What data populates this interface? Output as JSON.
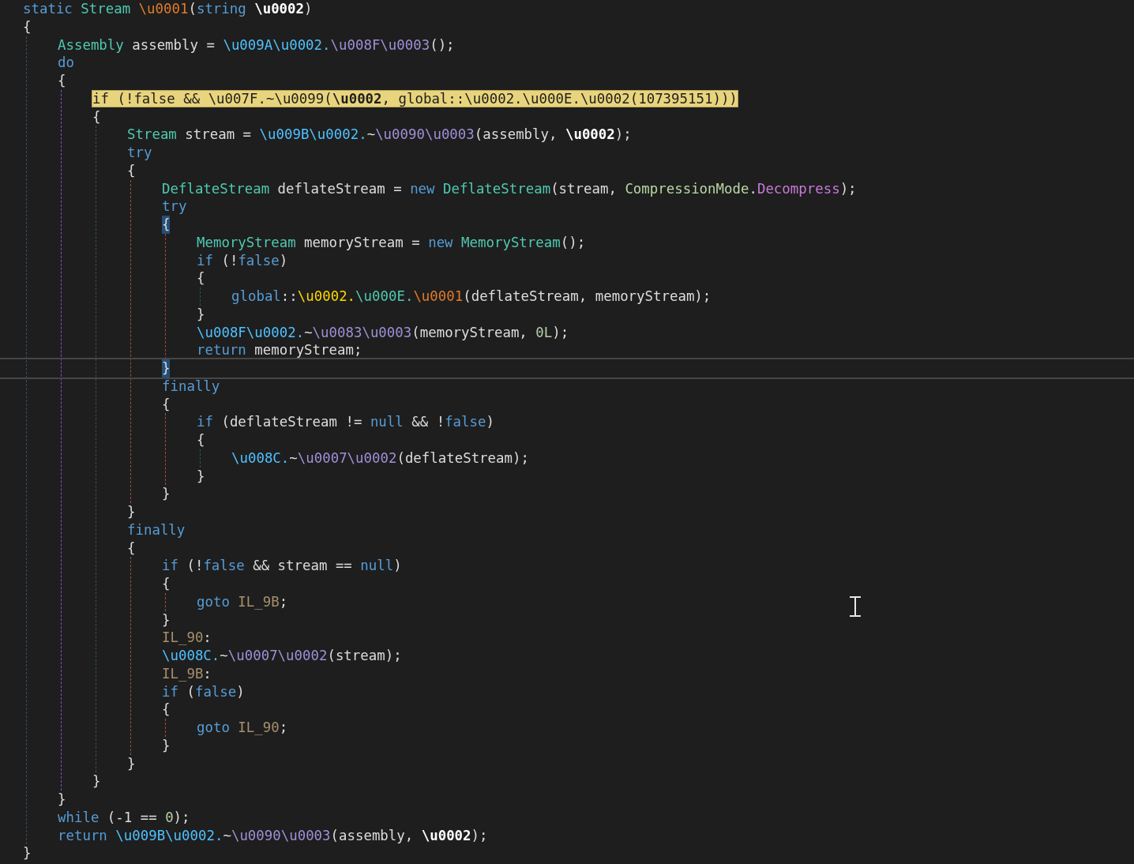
{
  "code": {
    "lines": [
      {
        "tokens": [
          {
            "text": "static ",
            "kind": "kw"
          },
          {
            "text": "Stream ",
            "kind": "type"
          },
          {
            "text": "\\u0001",
            "kind": "method"
          },
          {
            "text": "(",
            "kind": "id"
          },
          {
            "text": "string ",
            "kind": "kw"
          },
          {
            "text": "\\u0002",
            "kind": "param"
          },
          {
            "text": ")",
            "kind": "id"
          }
        ],
        "highlighted": false,
        "current": false,
        "brace_match": false
      },
      {
        "tokens": [
          {
            "text": "{",
            "kind": "id"
          }
        ],
        "highlighted": false,
        "current": false,
        "brace_match": false,
        "children": [
          {
            "tokens": [
              {
                "text": "Assembly",
                "kind": "type"
              },
              {
                "text": " assembly = ",
                "kind": "id"
              },
              {
                "text": "\\u009A\\u0002.",
                "kind": "class"
              },
              {
                "text": "\\u008F\\u0003",
                "kind": "call"
              },
              {
                "text": "();",
                "kind": "id"
              }
            ],
            "highlighted": false,
            "current": false,
            "brace_match": false
          },
          {
            "tokens": [
              {
                "text": "do",
                "kind": "kw"
              }
            ],
            "highlighted": false,
            "current": false,
            "brace_match": false
          },
          {
            "tokens": [
              {
                "text": "{",
                "kind": "id"
              }
            ],
            "highlighted": false,
            "current": false,
            "brace_match": false,
            "children": [
              {
                "tokens": [
                  {
                    "text": "if",
                    "kind": "kw"
                  },
                  {
                    "text": " (!",
                    "kind": "id"
                  },
                  {
                    "text": "false",
                    "kind": "kw"
                  },
                  {
                    "text": " && ",
                    "kind": "id"
                  },
                  {
                    "text": "\\u007F.",
                    "kind": "class"
                  },
                  {
                    "text": "~",
                    "kind": "id"
                  },
                  {
                    "text": "\\u0099",
                    "kind": "call"
                  },
                  {
                    "text": "(",
                    "kind": "id"
                  },
                  {
                    "text": "\\u0002",
                    "kind": "param"
                  },
                  {
                    "text": ", ",
                    "kind": "id"
                  },
                  {
                    "text": "global",
                    "kind": "kw"
                  },
                  {
                    "text": "::",
                    "kind": "id"
                  },
                  {
                    "text": "\\u0002.",
                    "kind": "field"
                  },
                  {
                    "text": "\\u000E.",
                    "kind": "static"
                  },
                  {
                    "text": "\\u0002",
                    "kind": "method"
                  },
                  {
                    "text": "(",
                    "kind": "id"
                  },
                  {
                    "text": "107395151",
                    "kind": "num"
                  },
                  {
                    "text": ")))",
                    "kind": "id"
                  }
                ],
                "highlighted": true,
                "current": false,
                "brace_match": false
              },
              {
                "tokens": [
                  {
                    "text": "{",
                    "kind": "id"
                  }
                ],
                "highlighted": false,
                "current": false,
                "brace_match": false,
                "children": [
                  {
                    "tokens": [
                      {
                        "text": "Stream",
                        "kind": "type"
                      },
                      {
                        "text": " stream = ",
                        "kind": "id"
                      },
                      {
                        "text": "\\u009B\\u0002.",
                        "kind": "class"
                      },
                      {
                        "text": "~",
                        "kind": "id"
                      },
                      {
                        "text": "\\u0090\\u0003",
                        "kind": "call"
                      },
                      {
                        "text": "(assembly, ",
                        "kind": "id"
                      },
                      {
                        "text": "\\u0002",
                        "kind": "param"
                      },
                      {
                        "text": ");",
                        "kind": "id"
                      }
                    ],
                    "highlighted": false,
                    "current": false,
                    "brace_match": false
                  },
                  {
                    "tokens": [
                      {
                        "text": "try",
                        "kind": "kw"
                      }
                    ],
                    "highlighted": false,
                    "current": false,
                    "brace_match": false
                  },
                  {
                    "tokens": [
                      {
                        "text": "{",
                        "kind": "id"
                      }
                    ],
                    "highlighted": false,
                    "current": false,
                    "brace_match": false,
                    "children": [
                      {
                        "tokens": [
                          {
                            "text": "DeflateStream",
                            "kind": "type"
                          },
                          {
                            "text": " deflateStream = ",
                            "kind": "id"
                          },
                          {
                            "text": "new ",
                            "kind": "kw"
                          },
                          {
                            "text": "DeflateStream",
                            "kind": "type"
                          },
                          {
                            "text": "(stream, ",
                            "kind": "id"
                          },
                          {
                            "text": "CompressionMode",
                            "kind": "enum"
                          },
                          {
                            "text": ".",
                            "kind": "id"
                          },
                          {
                            "text": "Decompress",
                            "kind": "member"
                          },
                          {
                            "text": ");",
                            "kind": "id"
                          }
                        ],
                        "highlighted": false,
                        "current": false,
                        "brace_match": false
                      },
                      {
                        "tokens": [
                          {
                            "text": "try",
                            "kind": "kw"
                          }
                        ],
                        "highlighted": false,
                        "current": false,
                        "brace_match": false
                      },
                      {
                        "tokens": [
                          {
                            "text": "{",
                            "kind": "id"
                          }
                        ],
                        "highlighted": false,
                        "current": false,
                        "brace_match": true,
                        "children": [
                          {
                            "tokens": [
                              {
                                "text": "MemoryStream",
                                "kind": "type"
                              },
                              {
                                "text": " memoryStream = ",
                                "kind": "id"
                              },
                              {
                                "text": "new ",
                                "kind": "kw"
                              },
                              {
                                "text": "MemoryStream",
                                "kind": "type"
                              },
                              {
                                "text": "();",
                                "kind": "id"
                              }
                            ],
                            "highlighted": false,
                            "current": false,
                            "brace_match": false
                          },
                          {
                            "tokens": [
                              {
                                "text": "if",
                                "kind": "kw"
                              },
                              {
                                "text": " (!",
                                "kind": "id"
                              },
                              {
                                "text": "false",
                                "kind": "kw"
                              },
                              {
                                "text": ")",
                                "kind": "id"
                              }
                            ],
                            "highlighted": false,
                            "current": false,
                            "brace_match": false
                          },
                          {
                            "tokens": [
                              {
                                "text": "{",
                                "kind": "id"
                              }
                            ],
                            "highlighted": false,
                            "current": false,
                            "brace_match": false,
                            "children": [
                              {
                                "tokens": [
                                  {
                                    "text": "global",
                                    "kind": "kw"
                                  },
                                  {
                                    "text": "::",
                                    "kind": "id"
                                  },
                                  {
                                    "text": "\\u0002.",
                                    "kind": "field"
                                  },
                                  {
                                    "text": "\\u000E.",
                                    "kind": "static"
                                  },
                                  {
                                    "text": "\\u0001",
                                    "kind": "method"
                                  },
                                  {
                                    "text": "(deflateStream, memoryStream);",
                                    "kind": "id"
                                  }
                                ],
                                "highlighted": false,
                                "current": false,
                                "brace_match": false
                              }
                            ]
                          },
                          {
                            "tokens": [
                              {
                                "text": "}",
                                "kind": "id"
                              }
                            ],
                            "highlighted": false,
                            "current": false,
                            "brace_match": false
                          },
                          {
                            "tokens": [
                              {
                                "text": "\\u008F\\u0002.",
                                "kind": "class"
                              },
                              {
                                "text": "~",
                                "kind": "id"
                              },
                              {
                                "text": "\\u0083\\u0003",
                                "kind": "call"
                              },
                              {
                                "text": "(memoryStream, ",
                                "kind": "id"
                              },
                              {
                                "text": "0L",
                                "kind": "num"
                              },
                              {
                                "text": ");",
                                "kind": "id"
                              }
                            ],
                            "highlighted": false,
                            "current": false,
                            "brace_match": false
                          },
                          {
                            "tokens": [
                              {
                                "text": "return",
                                "kind": "kw"
                              },
                              {
                                "text": " memoryStream;",
                                "kind": "id"
                              }
                            ],
                            "highlighted": false,
                            "current": false,
                            "brace_match": false
                          }
                        ]
                      },
                      {
                        "tokens": [
                          {
                            "text": "}",
                            "kind": "id"
                          }
                        ],
                        "highlighted": false,
                        "current": true,
                        "brace_match": true
                      },
                      {
                        "tokens": [
                          {
                            "text": "finally",
                            "kind": "kw"
                          }
                        ],
                        "highlighted": false,
                        "current": false,
                        "brace_match": false
                      },
                      {
                        "tokens": [
                          {
                            "text": "{",
                            "kind": "id"
                          }
                        ],
                        "highlighted": false,
                        "current": false,
                        "brace_match": false,
                        "children": [
                          {
                            "tokens": [
                              {
                                "text": "if",
                                "kind": "kw"
                              },
                              {
                                "text": " (deflateStream != ",
                                "kind": "id"
                              },
                              {
                                "text": "null",
                                "kind": "kw"
                              },
                              {
                                "text": " && !",
                                "kind": "id"
                              },
                              {
                                "text": "false",
                                "kind": "kw"
                              },
                              {
                                "text": ")",
                                "kind": "id"
                              }
                            ],
                            "highlighted": false,
                            "current": false,
                            "brace_match": false
                          },
                          {
                            "tokens": [
                              {
                                "text": "{",
                                "kind": "id"
                              }
                            ],
                            "highlighted": false,
                            "current": false,
                            "brace_match": false,
                            "children": [
                              {
                                "tokens": [
                                  {
                                    "text": "\\u008C.",
                                    "kind": "class"
                                  },
                                  {
                                    "text": "~",
                                    "kind": "id"
                                  },
                                  {
                                    "text": "\\u0007\\u0002",
                                    "kind": "call"
                                  },
                                  {
                                    "text": "(deflateStream);",
                                    "kind": "id"
                                  }
                                ],
                                "highlighted": false,
                                "current": false,
                                "brace_match": false
                              }
                            ]
                          },
                          {
                            "tokens": [
                              {
                                "text": "}",
                                "kind": "id"
                              }
                            ],
                            "highlighted": false,
                            "current": false,
                            "brace_match": false
                          }
                        ]
                      },
                      {
                        "tokens": [
                          {
                            "text": "}",
                            "kind": "id"
                          }
                        ],
                        "highlighted": false,
                        "current": false,
                        "brace_match": false
                      }
                    ]
                  },
                  {
                    "tokens": [
                      {
                        "text": "}",
                        "kind": "id"
                      }
                    ],
                    "highlighted": false,
                    "current": false,
                    "brace_match": false
                  },
                  {
                    "tokens": [
                      {
                        "text": "finally",
                        "kind": "kw"
                      }
                    ],
                    "highlighted": false,
                    "current": false,
                    "brace_match": false
                  },
                  {
                    "tokens": [
                      {
                        "text": "{",
                        "kind": "id"
                      }
                    ],
                    "highlighted": false,
                    "current": false,
                    "brace_match": false,
                    "children": [
                      {
                        "tokens": [
                          {
                            "text": "if",
                            "kind": "kw"
                          },
                          {
                            "text": " (!",
                            "kind": "id"
                          },
                          {
                            "text": "false",
                            "kind": "kw"
                          },
                          {
                            "text": " && stream == ",
                            "kind": "id"
                          },
                          {
                            "text": "null",
                            "kind": "kw"
                          },
                          {
                            "text": ")",
                            "kind": "id"
                          }
                        ],
                        "highlighted": false,
                        "current": false,
                        "brace_match": false
                      },
                      {
                        "tokens": [
                          {
                            "text": "{",
                            "kind": "id"
                          }
                        ],
                        "highlighted": false,
                        "current": false,
                        "brace_match": false,
                        "children": [
                          {
                            "tokens": [
                              {
                                "text": "goto ",
                                "kind": "kw"
                              },
                              {
                                "text": "IL_9B",
                                "kind": "label"
                              },
                              {
                                "text": ";",
                                "kind": "id"
                              }
                            ],
                            "highlighted": false,
                            "current": false,
                            "brace_match": false
                          }
                        ]
                      },
                      {
                        "tokens": [
                          {
                            "text": "}",
                            "kind": "id"
                          }
                        ],
                        "highlighted": false,
                        "current": false,
                        "brace_match": false
                      },
                      {
                        "tokens": [
                          {
                            "text": "IL_90",
                            "kind": "label"
                          },
                          {
                            "text": ":",
                            "kind": "id"
                          }
                        ],
                        "highlighted": false,
                        "current": false,
                        "brace_match": false
                      },
                      {
                        "tokens": [
                          {
                            "text": "\\u008C.",
                            "kind": "class"
                          },
                          {
                            "text": "~",
                            "kind": "id"
                          },
                          {
                            "text": "\\u0007\\u0002",
                            "kind": "call"
                          },
                          {
                            "text": "(stream);",
                            "kind": "id"
                          }
                        ],
                        "highlighted": false,
                        "current": false,
                        "brace_match": false
                      },
                      {
                        "tokens": [
                          {
                            "text": "IL_9B",
                            "kind": "label"
                          },
                          {
                            "text": ":",
                            "kind": "id"
                          }
                        ],
                        "highlighted": false,
                        "current": false,
                        "brace_match": false
                      },
                      {
                        "tokens": [
                          {
                            "text": "if",
                            "kind": "kw"
                          },
                          {
                            "text": " (",
                            "kind": "id"
                          },
                          {
                            "text": "false",
                            "kind": "kw"
                          },
                          {
                            "text": ")",
                            "kind": "id"
                          }
                        ],
                        "highlighted": false,
                        "current": false,
                        "brace_match": false
                      },
                      {
                        "tokens": [
                          {
                            "text": "{",
                            "kind": "id"
                          }
                        ],
                        "highlighted": false,
                        "current": false,
                        "brace_match": false,
                        "children": [
                          {
                            "tokens": [
                              {
                                "text": "goto ",
                                "kind": "kw"
                              },
                              {
                                "text": "IL_90",
                                "kind": "label"
                              },
                              {
                                "text": ";",
                                "kind": "id"
                              }
                            ],
                            "highlighted": false,
                            "current": false,
                            "brace_match": false
                          }
                        ]
                      },
                      {
                        "tokens": [
                          {
                            "text": "}",
                            "kind": "id"
                          }
                        ],
                        "highlighted": false,
                        "current": false,
                        "brace_match": false
                      }
                    ]
                  },
                  {
                    "tokens": [
                      {
                        "text": "}",
                        "kind": "id"
                      }
                    ],
                    "highlighted": false,
                    "current": false,
                    "brace_match": false
                  }
                ]
              },
              {
                "tokens": [
                  {
                    "text": "}",
                    "kind": "id"
                  }
                ],
                "highlighted": false,
                "current": false,
                "brace_match": false
              }
            ]
          },
          {
            "tokens": [
              {
                "text": "}",
                "kind": "id"
              }
            ],
            "highlighted": false,
            "current": false,
            "brace_match": false
          },
          {
            "tokens": [
              {
                "text": "while",
                "kind": "kw"
              },
              {
                "text": " (-1 == ",
                "kind": "id"
              },
              {
                "text": "0",
                "kind": "num"
              },
              {
                "text": ");",
                "kind": "id"
              }
            ],
            "highlighted": false,
            "current": false,
            "brace_match": false
          },
          {
            "tokens": [
              {
                "text": "return ",
                "kind": "kw"
              },
              {
                "text": "\\u009B\\u0002.",
                "kind": "class"
              },
              {
                "text": "~",
                "kind": "id"
              },
              {
                "text": "\\u0090\\u0003",
                "kind": "call"
              },
              {
                "text": "(assembly, ",
                "kind": "id"
              },
              {
                "text": "\\u0002",
                "kind": "param"
              },
              {
                "text": ");",
                "kind": "id"
              }
            ],
            "highlighted": false,
            "current": false,
            "brace_match": false
          }
        ]
      },
      {
        "tokens": [
          {
            "text": "}",
            "kind": "id"
          }
        ],
        "highlighted": false,
        "current": false,
        "brace_match": false
      }
    ]
  }
}
